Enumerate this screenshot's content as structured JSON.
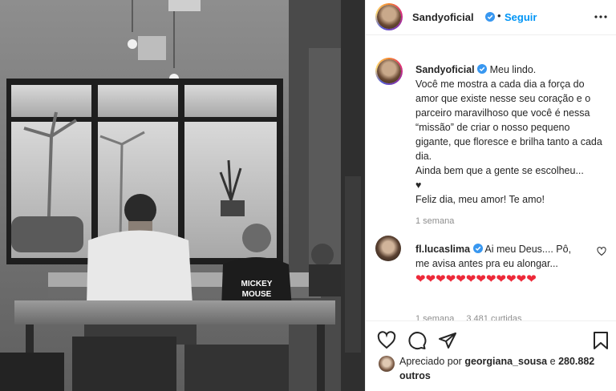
{
  "post": {
    "username": "Sandyoficial",
    "follow_label": "Seguir",
    "separator": "•",
    "icons": {
      "verified": "verified-badge-icon",
      "more": "more-options-icon",
      "like": "heart-outline-icon",
      "comment": "comment-bubble-icon",
      "share": "paper-plane-icon",
      "save": "bookmark-icon"
    },
    "brand_colors": {
      "link": "#0095f6",
      "verified": "#3897f0",
      "heart": "#ed2939",
      "muted": "#8e8e8e"
    }
  },
  "caption": {
    "username": "Sandyoficial",
    "lines": [
      "Meu lindo.",
      "Você me mostra a cada dia a força do amor que existe nesse seu coração e o parceiro maravilhoso que você é nessa “missão” de criar o nosso pequeno gigante, que floresce e brilha tanto a cada dia.",
      "Ainda bem que a gente se escolheu...",
      "♥",
      "Feliz dia, meu amor! Te amo!"
    ],
    "time": "1 semana"
  },
  "comment": {
    "username": "fl.lucaslima",
    "text": "Ai meu Deus.... Pô, me avisa antes pra eu alongar...",
    "hearts": "❤❤❤❤❤❤❤❤❤❤❤❤",
    "time": "1 semana",
    "likes": "3.481 curtidas"
  },
  "likes_summary": {
    "prefix": "Apreciado por",
    "user": "georgiana_sousa",
    "conj": "e",
    "count": "280.882 outros"
  },
  "photo": {
    "shirt_text_1": "MICKEY",
    "shirt_text_2": "MOUSE"
  }
}
